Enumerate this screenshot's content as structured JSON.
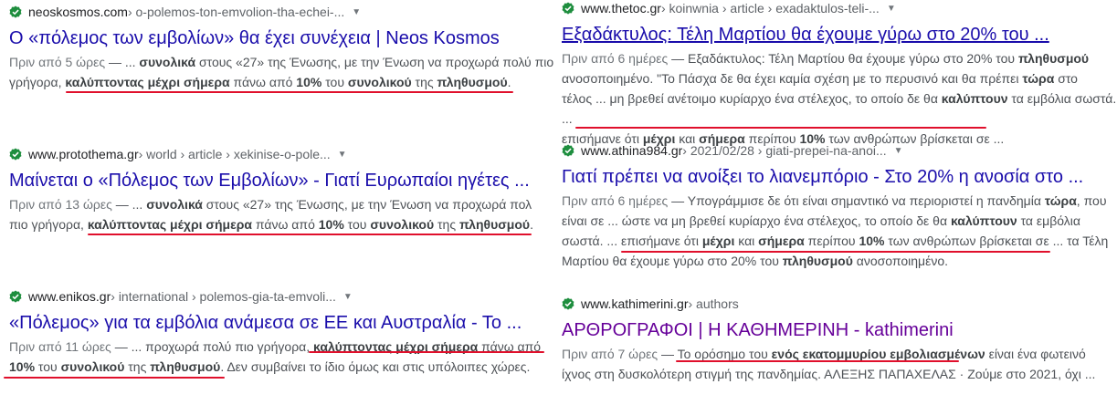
{
  "left": [
    {
      "domain": "neoskosmos.com",
      "path": " › o-polemos-ton-emvolion-tha-echei-...",
      "title": "Ο «πόλεμος των εμβολίων» θα έχει συνέχεια | Neos Kosmos",
      "date": "Πριν από 5 ώρες",
      "line1": [
        {
          "t": " — ... "
        },
        {
          "t": "συνολικά",
          "b": true
        },
        {
          "t": " στους «27» της Ένωσης, με την Ένωση να προχωρά πολύ πιο"
        }
      ],
      "line2": [
        {
          "t": "γρήγορα, "
        },
        {
          "t": "καλύπτοντας μέχρι σήμερα",
          "b": true
        },
        {
          "t": " πάνω από "
        },
        {
          "t": "10%",
          "b": true
        },
        {
          "t": " του "
        },
        {
          "t": "συνολικού",
          "b": true
        },
        {
          "t": " της "
        },
        {
          "t": "πληθυσμού",
          "b": true
        },
        {
          "t": "."
        }
      ]
    },
    {
      "domain": "www.protothema.gr",
      "path": " › world › article › xekinise-o-pole...",
      "title": "Μαίνεται ο «Πόλεμος των Εμβολίων» - Γιατί Ευρωπαίοι ηγέτες ...",
      "date": "Πριν από 13 ώρες",
      "line1": [
        {
          "t": " — ... "
        },
        {
          "t": "συνολικά",
          "b": true
        },
        {
          "t": " στους «27» της Ένωσης, με την Ένωση να προχωρά πολ"
        }
      ],
      "line2": [
        {
          "t": "πιο γρήγορα, "
        },
        {
          "t": "καλύπτοντας μέχρι σήμερα",
          "b": true
        },
        {
          "t": " πάνω από "
        },
        {
          "t": "10%",
          "b": true
        },
        {
          "t": " του "
        },
        {
          "t": "συνολικού",
          "b": true
        },
        {
          "t": " της "
        },
        {
          "t": "πληθυσμού",
          "b": true
        },
        {
          "t": "."
        }
      ]
    },
    {
      "domain": "www.enikos.gr",
      "path": " › international › polemos-gia-ta-emvoli...",
      "title": "«Πόλεμος» για τα εμβόλια ανάμεσα σε ΕΕ και Αυστραλία - Το ...",
      "date": "Πριν από 11 ώρες",
      "line1": [
        {
          "t": " — ... προχωρά πολύ πιο γρήγορα, "
        },
        {
          "t": "καλύπτοντας μέχρι σήμερα",
          "b": true
        },
        {
          "t": " πάνω από"
        }
      ],
      "line2": [
        {
          "t": "10%",
          "b": true
        },
        {
          "t": " του "
        },
        {
          "t": "συνολικού",
          "b": true
        },
        {
          "t": " της "
        },
        {
          "t": "πληθυσμού",
          "b": true
        },
        {
          "t": ". Δεν συμβαίνει το ίδιο όμως και στις υπόλοιπες χώρες."
        }
      ]
    }
  ],
  "right": [
    {
      "domain": "www.thetoc.gr",
      "path": " › koinwnia › article › exadaktulos-teli-...",
      "title": "Εξαδάκτυλος: Τέλη Μαρτίου θα έχουμε γύρω στο 20% του ...",
      "date": "Πριν από 6 ημέρες",
      "line1": [
        {
          "t": " — Εξαδάκτυλος: Τέλη Μαρτίου θα έχουμε γύρω στο 20% του "
        },
        {
          "t": "πληθυσμού",
          "b": true
        }
      ],
      "line2": [
        {
          "t": "ανοσοποιημένο. \"Το Πάσχα δε θα έχει καμία σχέση με το περυσινό και θα πρέπει "
        },
        {
          "t": "τώρα",
          "b": true
        },
        {
          "t": " στο"
        }
      ],
      "line3": [
        {
          "t": "τέλος ... μη βρεθεί ανέτοιμο κυρίαρχο ένα στέλεχος, το οποίο δε θα "
        },
        {
          "t": "καλύπτουν",
          "b": true
        },
        {
          "t": " τα εμβόλια σωστά. ..."
        }
      ],
      "line4": [
        {
          "t": "επισήμανε ότι "
        },
        {
          "t": "μέχρι",
          "b": true
        },
        {
          "t": " και "
        },
        {
          "t": "σήμερα",
          "b": true
        },
        {
          "t": " περίπου "
        },
        {
          "t": "10%",
          "b": true
        },
        {
          "t": " των ανθρώπων βρίσκεται σε ..."
        }
      ]
    },
    {
      "domain": "www.athina984.gr",
      "path": " › 2021/02/28 › giati-prepei-na-anoi...",
      "title": "Γιατί πρέπει να ανοίξει το λιανεμπόριο - Στο 20% η ανοσία στο ...",
      "date": "Πριν από 6 ημέρες",
      "line1": [
        {
          "t": " — Υπογράμμισε δε ότι είναι σημαντικό να περιοριστεί η πανδημία "
        },
        {
          "t": "τώρα",
          "b": true
        },
        {
          "t": ", που"
        }
      ],
      "line2": [
        {
          "t": "είναι σε ... ώστε να μη βρεθεί κυρίαρχο ένα στέλεχος, το οποίο δε θα "
        },
        {
          "t": "καλύπτουν",
          "b": true
        },
        {
          "t": " τα εμβόλια"
        }
      ],
      "line3": [
        {
          "t": "σωστά. ... "
        },
        {
          "t": "επισήμανε ότι "
        },
        {
          "t": "μέχρι",
          "b": true
        },
        {
          "t": " και "
        },
        {
          "t": "σήμερα",
          "b": true
        },
        {
          "t": " περίπου "
        },
        {
          "t": "10%",
          "b": true
        },
        {
          "t": " των ανθρώπων βρίσκεται σε ... τα Τέλη"
        }
      ],
      "line4": [
        {
          "t": "Μαρτίου θα έχουμε γύρω στο 20% του "
        },
        {
          "t": "πληθυσμού",
          "b": true
        },
        {
          "t": " ανοσοποιημένο."
        }
      ]
    },
    {
      "domain": "www.kathimerini.gr",
      "path": " › authors",
      "title": "ΑΡΘΡΟΓΡΑΦΟΙ | Η ΚΑΘΗΜΕΡΙΝΗ - kathimerini",
      "date": "Πριν από 7 ώρες",
      "line1": [
        {
          "t": " — Το ορόσημο του "
        },
        {
          "t": "ενός εκατομμυρίου εμβολιασμένων",
          "b": true
        },
        {
          "t": " είναι ένα φωτεινό"
        }
      ],
      "line2": [
        {
          "t": "ίχνος στη δυσκολότερη στιγμή της πανδημίας. ΑΛΕΞΗΣ ΠΑΠΑΧΕΛΑΣ · Ζούμε στο 2021, όχι ..."
        }
      ]
    }
  ],
  "colors": {
    "link": "#1a0dab",
    "visited": "#660099",
    "check": "#1e8e3e",
    "highlight": "#e0102c"
  }
}
